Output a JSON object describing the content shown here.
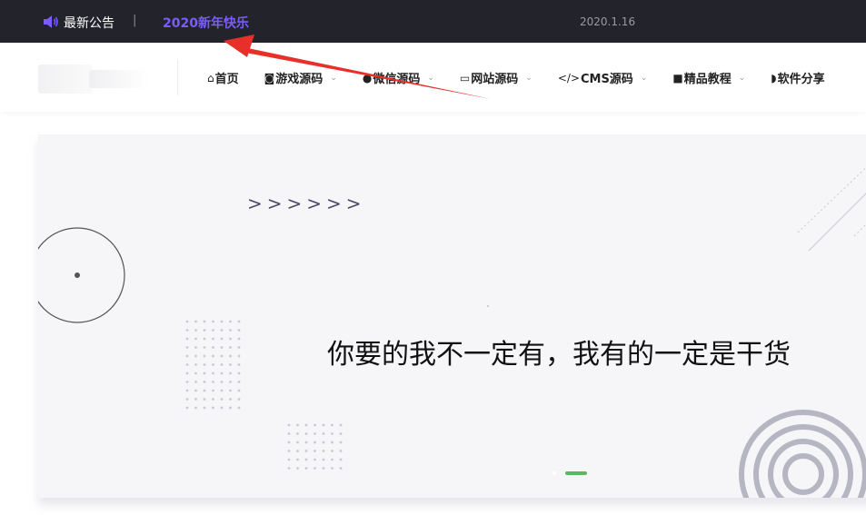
{
  "topbar": {
    "notice_label": "最新公告",
    "separator": "|",
    "notice_text": "2020新年快乐",
    "notice_date": "2020.1.16",
    "accent_color": "#7b5cff"
  },
  "nav": {
    "items": [
      {
        "icon": "home-icon",
        "glyph": "⌂",
        "label": "首页",
        "has_dropdown": false
      },
      {
        "icon": "gamepad-icon",
        "glyph": "◙",
        "label": "游戏源码",
        "has_dropdown": true
      },
      {
        "icon": "wechat-icon",
        "glyph": "●",
        "label": "微信源码",
        "has_dropdown": true
      },
      {
        "icon": "monitor-icon",
        "glyph": "▭",
        "label": "网站源码",
        "has_dropdown": true
      },
      {
        "icon": "code-icon",
        "glyph": "</>",
        "label": "CMS源码",
        "has_dropdown": true
      },
      {
        "icon": "video-icon",
        "glyph": "■",
        "label": "精品教程",
        "has_dropdown": true
      },
      {
        "icon": "shield-icon",
        "glyph": "◗",
        "label": "软件分享",
        "has_dropdown": false
      }
    ],
    "chevron": "⌄"
  },
  "banner": {
    "arrows": ">>>>>>",
    "slogan": "你要的我不一定有，我有的一定是干货",
    "active_dot_color": "#5cb85c"
  },
  "annotation": {
    "arrow_color": "#e8302a"
  }
}
